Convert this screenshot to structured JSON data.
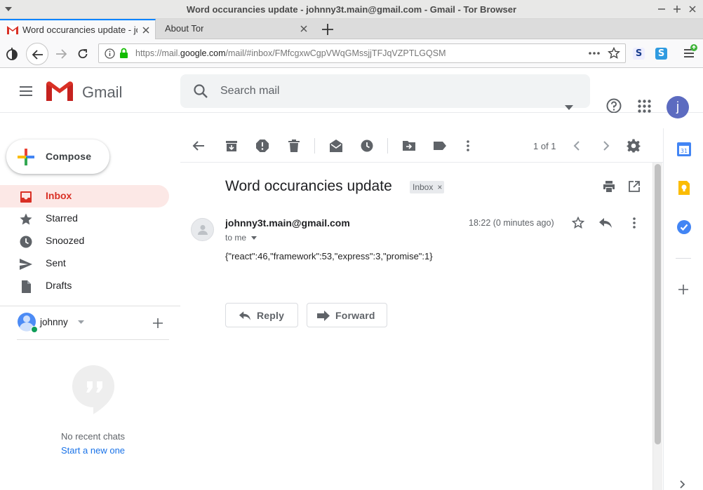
{
  "window": {
    "title": "Word occurancies update - johnny3t.main@gmail.com - Gmail - Tor Browser"
  },
  "tabs": [
    {
      "label": "Word occurancies update - joh",
      "active": true,
      "icon": "gmail-icon"
    },
    {
      "label": "About Tor",
      "active": false
    }
  ],
  "navbar": {
    "url_prefix": "https://mail.",
    "url_domain": "google.com",
    "url_suffix": "/mail/#inbox/FMfcgxwCgpVWqGMssjjTFJqVZPTLGQSM"
  },
  "gmail": {
    "brand": "Gmail",
    "search_placeholder": "Search mail",
    "avatar_letter": "j",
    "accent": "#d93025",
    "compose_label": "Compose",
    "nav": [
      {
        "label": "Inbox",
        "icon": "inbox-icon",
        "active": true
      },
      {
        "label": "Starred",
        "icon": "star-icon",
        "active": false
      },
      {
        "label": "Snoozed",
        "icon": "clock-icon",
        "active": false
      },
      {
        "label": "Sent",
        "icon": "send-icon",
        "active": false
      },
      {
        "label": "Drafts",
        "icon": "draft-icon",
        "active": false
      }
    ],
    "hangouts": {
      "user": "johnny",
      "no_recent": "No recent chats",
      "start_new": "Start a new one"
    }
  },
  "toolbar": {
    "pager": "1 of 1"
  },
  "message": {
    "subject": "Word occurancies update",
    "label_chip": "Inbox",
    "label_chip_close": "×",
    "sender": "johnny3t.main@gmail.com",
    "to": "to me",
    "time": "18:22 (0 minutes ago)",
    "body": "{\"react\":46,\"framework\":53,\"express\":3,\"promise\":1}",
    "reply_label": "Reply",
    "forward_label": "Forward"
  }
}
